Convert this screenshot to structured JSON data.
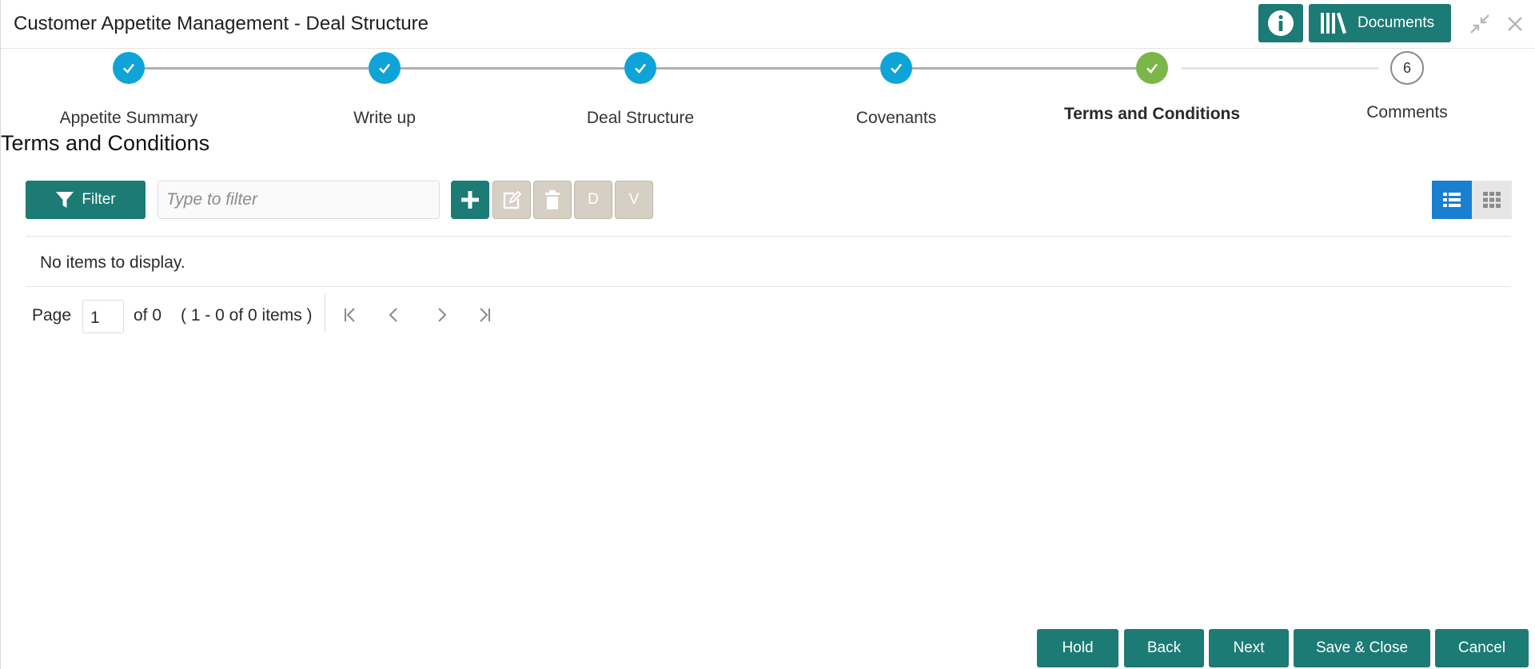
{
  "header": {
    "title": "Customer Appetite Management - Deal Structure",
    "documents_label": "Documents",
    "icons": [
      "info-icon",
      "documents-icon",
      "minimize-icon",
      "close-icon"
    ]
  },
  "stepper": {
    "steps": [
      {
        "label": "Appetite Summary",
        "state": "done"
      },
      {
        "label": "Write up",
        "state": "done"
      },
      {
        "label": "Deal Structure",
        "state": "done"
      },
      {
        "label": "Covenants",
        "state": "done"
      },
      {
        "label": "Terms and Conditions",
        "state": "current"
      },
      {
        "label": "Comments",
        "state": "pending",
        "number": "6"
      }
    ]
  },
  "section": {
    "title": "Terms and Conditions"
  },
  "toolbar": {
    "filter_label": "Filter",
    "filter_placeholder": "Type to filter",
    "d_label": "D",
    "v_label": "V"
  },
  "grid": {
    "empty_message": "No items to display."
  },
  "pager": {
    "page_label": "Page",
    "page_value": "1",
    "of_label": "of 0",
    "items_label": "( 1 - 0 of 0 items )"
  },
  "footer": {
    "hold": "Hold",
    "back": "Back",
    "next": "Next",
    "save_close": "Save & Close",
    "cancel": "Cancel"
  },
  "colors": {
    "primary": "#1c7b74",
    "step_done": "#0ea4d8",
    "step_current": "#7ab648",
    "disabled": "#d6cfc3",
    "view_active": "#1a7fd1"
  }
}
